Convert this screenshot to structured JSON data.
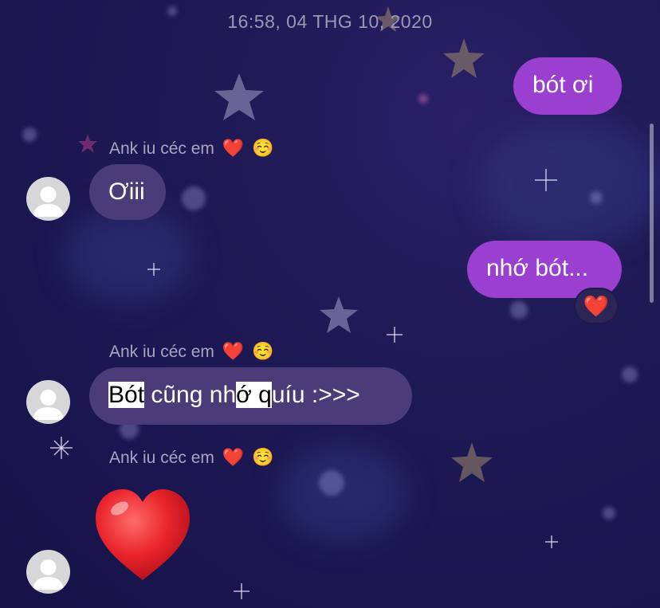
{
  "timestamp": "16:58, 04 THG 10, 2020",
  "messages": [
    {
      "direction": "out",
      "text": "bót ơi"
    },
    {
      "direction": "in",
      "sender": "Ank iu céc em ❤️ ☺️",
      "text": "Ơiii"
    },
    {
      "direction": "out",
      "text": "nhớ bót...",
      "reaction": "❤️"
    },
    {
      "direction": "in",
      "sender": "Ank iu céc em ❤️ ☺️",
      "text_parts": [
        "Bót",
        " cũng nh",
        "ớ q",
        "uíu :>>>"
      ]
    },
    {
      "direction": "in",
      "sender": "Ank iu céc em ❤️ ☺️",
      "sticker": "red-heart-emoji"
    }
  ],
  "sender_name": "Ank iu céc em",
  "sender_emojis": [
    "❤️",
    "☺️"
  ],
  "icons": [
    "avatar-placeholder-icon",
    "heart-reaction-icon",
    "big-heart-icon"
  ],
  "colors": {
    "background": "#1a1650",
    "outgoing_bubble": "#9a3fd0",
    "incoming_bubble": "#493c78",
    "timestamp_text": "#9b97b5",
    "sender_text": "#a8a4c4",
    "avatar": "#d7d7da"
  }
}
